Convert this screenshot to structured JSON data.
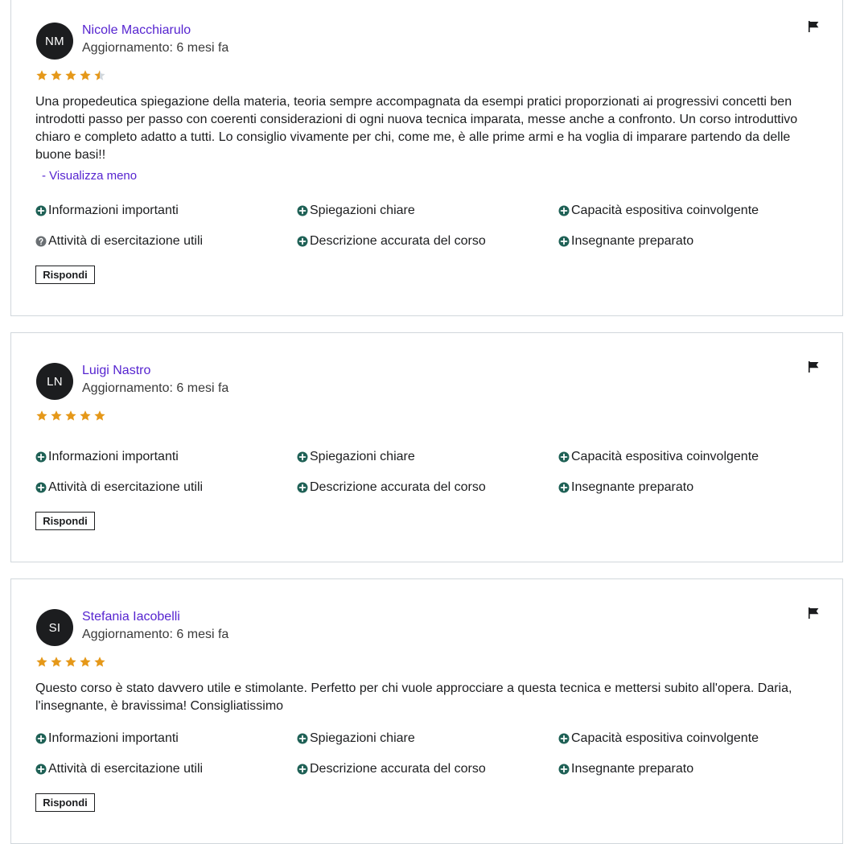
{
  "reviews": [
    {
      "initials": "NM",
      "name": "Nicole Macchiarulo",
      "updated": "Aggiornamento: 6 mesi fa",
      "rating": 4.5,
      "text": "Una propedeutica spiegazione della materia, teoria sempre accompagnata da esempi pratici proporzionati ai progressivi concetti ben introdotti passo per passo con coerenti considerazioni di ogni nuova tecnica imparata, messe anche a confronto. Un corso introduttivo chiaro e completo adatto a tutti. Lo consiglio vivamente per chi, come me, è alle prime armi e ha voglia di imparare partendo da delle buone basi!!",
      "toggle": "- Visualizza meno",
      "tags": [
        {
          "label": "Informazioni importanti",
          "icon": "plus-circle-icon"
        },
        {
          "label": "Spiegazioni chiare",
          "icon": "plus-circle-icon"
        },
        {
          "label": "Capacità espositiva coinvolgente",
          "icon": "plus-circle-icon"
        },
        {
          "label": "Attività di esercitazione utili",
          "icon": "question-circle-icon"
        },
        {
          "label": "Descrizione accurata del corso",
          "icon": "plus-circle-icon"
        },
        {
          "label": "Insegnante preparato",
          "icon": "plus-circle-icon"
        }
      ],
      "reply_label": "Rispondi"
    },
    {
      "initials": "LN",
      "name": "Luigi Nastro",
      "updated": "Aggiornamento: 6 mesi fa",
      "rating": 5,
      "tags": [
        {
          "label": "Informazioni importanti",
          "icon": "plus-circle-icon"
        },
        {
          "label": "Spiegazioni chiare",
          "icon": "plus-circle-icon"
        },
        {
          "label": "Capacità espositiva coinvolgente",
          "icon": "plus-circle-icon"
        },
        {
          "label": "Attività di esercitazione utili",
          "icon": "plus-circle-icon"
        },
        {
          "label": "Descrizione accurata del corso",
          "icon": "plus-circle-icon"
        },
        {
          "label": "Insegnante preparato",
          "icon": "plus-circle-icon"
        }
      ],
      "reply_label": "Rispondi"
    },
    {
      "initials": "SI",
      "name": "Stefania Iacobelli",
      "updated": "Aggiornamento: 6 mesi fa",
      "rating": 5,
      "text": "Questo corso è stato davvero utile e stimolante. Perfetto per chi vuole approcciare a questa tecnica e mettersi subito all'opera. Daria, l'insegnante, è bravissima! Consigliatissimo",
      "tags": [
        {
          "label": "Informazioni importanti",
          "icon": "plus-circle-icon"
        },
        {
          "label": "Spiegazioni chiare",
          "icon": "plus-circle-icon"
        },
        {
          "label": "Capacità espositiva coinvolgente",
          "icon": "plus-circle-icon"
        },
        {
          "label": "Attività di esercitazione utili",
          "icon": "plus-circle-icon"
        },
        {
          "label": "Descrizione accurata del corso",
          "icon": "plus-circle-icon"
        },
        {
          "label": "Insegnante preparato",
          "icon": "plus-circle-icon"
        }
      ],
      "reply_label": "Rispondi"
    }
  ],
  "colors": {
    "star": "#e59819",
    "star_empty": "#d1d7dc",
    "tag_icon": "#1e6055",
    "question_icon": "#6a6f73",
    "link": "#5624d0"
  }
}
